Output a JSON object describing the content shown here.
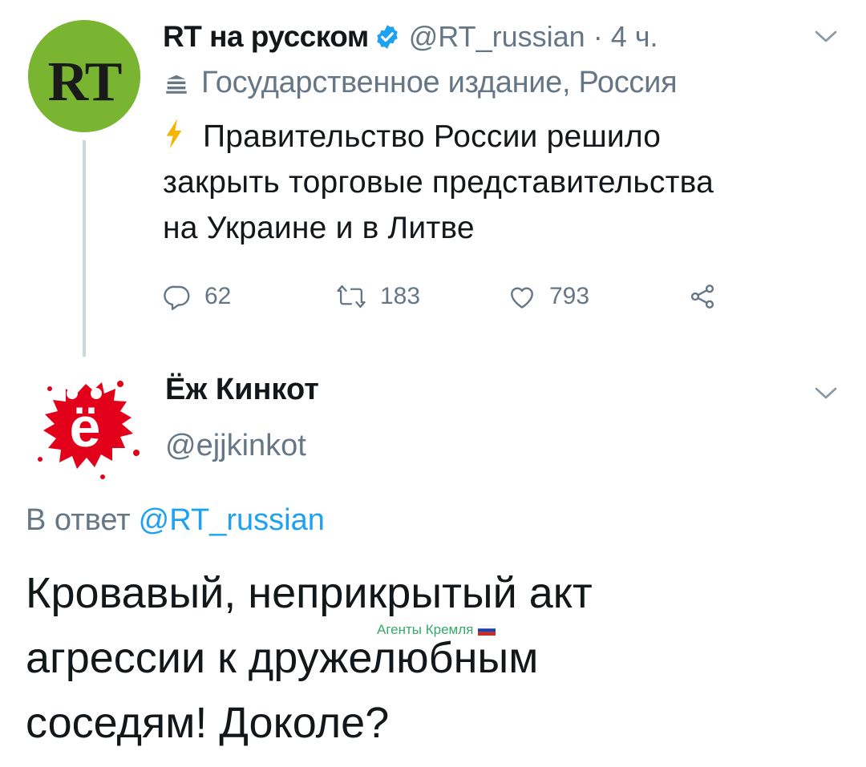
{
  "tweet1": {
    "author_name": "RT на русском",
    "handle": "@RT_russian",
    "separator": "·",
    "time": "4 ч.",
    "gov_label": "Государственное издание, Россия",
    "text_lines": [
      "Правительство России решило",
      "закрыть торговые представительства",
      "на Украине и в Литве"
    ],
    "avatar_text": "RT",
    "replies": "62",
    "retweets": "183",
    "likes": "793"
  },
  "tweet2": {
    "author_name": "Ёж Кинкот",
    "handle": "@ejjkinkot",
    "reply_prefix": "В ответ",
    "reply_mention": "@RT_russian",
    "text_lines": [
      "Кровавый, неприкрытый акт",
      "агрессии к дружелюбным",
      "соседям! Доколе?"
    ],
    "avatar_letter": "ё"
  },
  "watermark": "Агенты Кремля",
  "colors": {
    "rt_green": "#79b531",
    "verified_blue": "#1da1f2",
    "muted": "#657786",
    "text": "#14171a",
    "bolt": "#f5b400",
    "ezh_red": "#e3001b",
    "watermark_green": "#35a96a"
  },
  "icons": [
    "verified-icon",
    "chevron-down-icon",
    "government-icon",
    "lightning-icon",
    "reply-icon",
    "retweet-icon",
    "like-icon",
    "share-icon"
  ]
}
